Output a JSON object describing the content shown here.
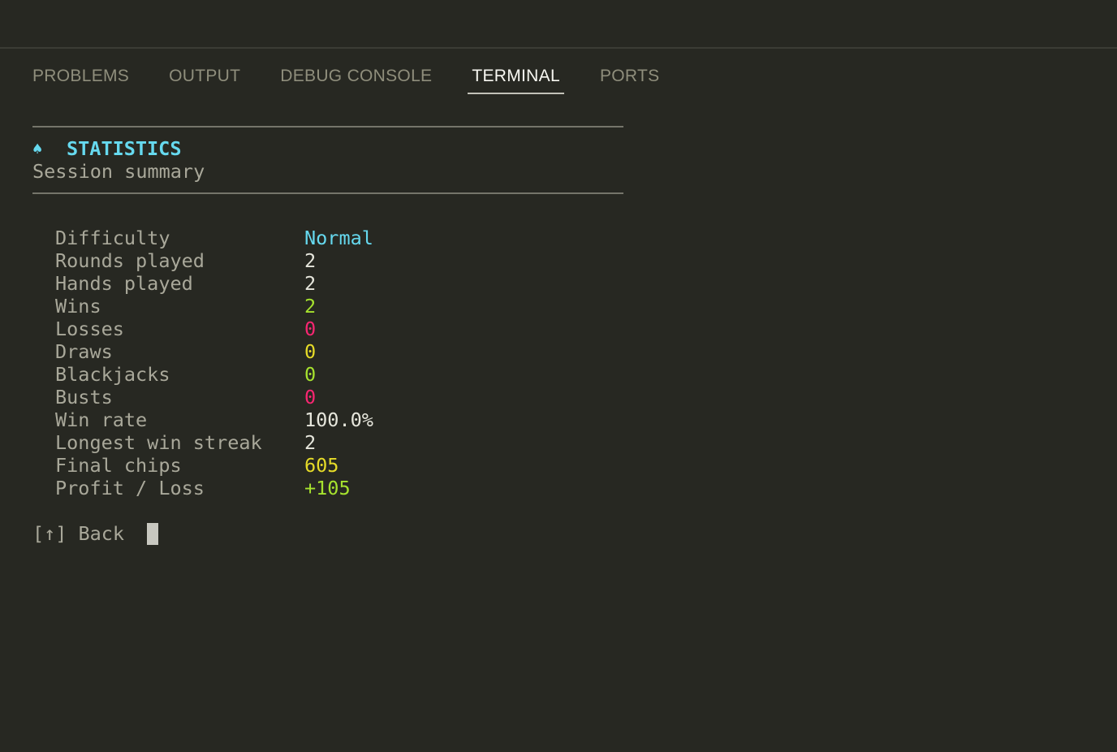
{
  "panel": {
    "tabs": [
      {
        "label": "PROBLEMS",
        "active": false
      },
      {
        "label": "OUTPUT",
        "active": false
      },
      {
        "label": "DEBUG CONSOLE",
        "active": false
      },
      {
        "label": "TERMINAL",
        "active": true
      },
      {
        "label": "PORTS",
        "active": false
      }
    ]
  },
  "terminal": {
    "icon": "spade-icon",
    "icon_glyph": "♠",
    "title": "STATISTICS",
    "subtitle": "Session summary",
    "stats": [
      {
        "label": "Difficulty",
        "value": "Normal",
        "color": "#66d9ef"
      },
      {
        "label": "Rounds played",
        "value": "2",
        "color": "#e6e6dc"
      },
      {
        "label": "Hands played",
        "value": "2",
        "color": "#e6e6dc"
      },
      {
        "label": "Wins",
        "value": "2",
        "color": "#a6e22e"
      },
      {
        "label": "Losses",
        "value": "0",
        "color": "#f92672"
      },
      {
        "label": "Draws",
        "value": "0",
        "color": "#e6db28"
      },
      {
        "label": "Blackjacks",
        "value": "0",
        "color": "#a6e22e"
      },
      {
        "label": "Busts",
        "value": "0",
        "color": "#f92672"
      },
      {
        "label": "Win rate",
        "value": "100.0%",
        "color": "#e6e6dc"
      },
      {
        "label": "Longest win streak",
        "value": "2",
        "color": "#e6e6dc"
      },
      {
        "label": "Final chips",
        "value": "605",
        "color": "#e6db28"
      },
      {
        "label": "Profit / Loss",
        "value": "+105",
        "color": "#a6e22e"
      }
    ],
    "back_key": "[↑]",
    "back_label": "Back"
  }
}
